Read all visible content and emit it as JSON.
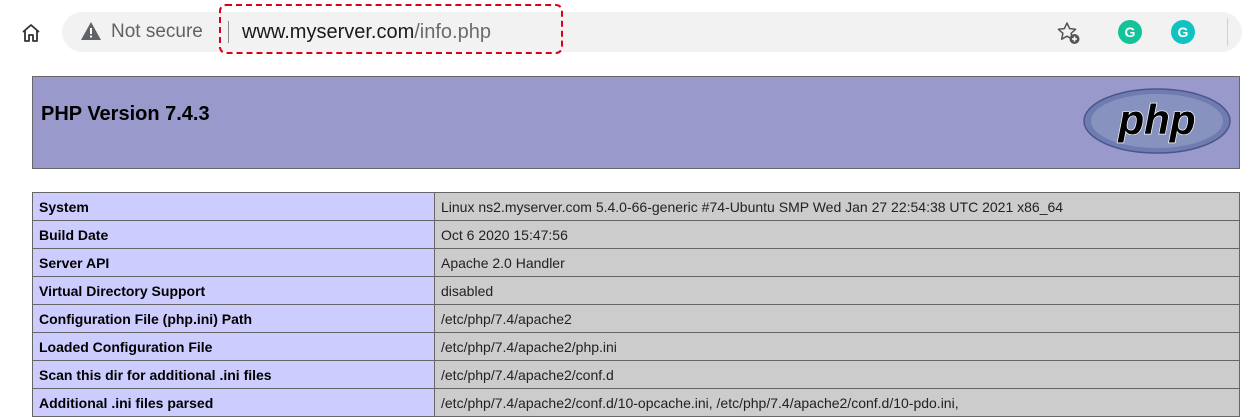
{
  "browser": {
    "security_label": "Not secure",
    "url_host": "www.myserver.com",
    "url_path": "/info.php",
    "extension_1": "G",
    "extension_2": "G"
  },
  "phpinfo": {
    "title": "PHP Version 7.4.3",
    "logo_text": "php",
    "rows": [
      {
        "key": "System",
        "value": "Linux ns2.myserver.com 5.4.0-66-generic #74-Ubuntu SMP Wed Jan 27 22:54:38 UTC 2021 x86_64"
      },
      {
        "key": "Build Date",
        "value": "Oct 6 2020 15:47:56"
      },
      {
        "key": "Server API",
        "value": "Apache 2.0 Handler"
      },
      {
        "key": "Virtual Directory Support",
        "value": "disabled"
      },
      {
        "key": "Configuration File (php.ini) Path",
        "value": "/etc/php/7.4/apache2"
      },
      {
        "key": "Loaded Configuration File",
        "value": "/etc/php/7.4/apache2/php.ini"
      },
      {
        "key": "Scan this dir for additional .ini files",
        "value": "/etc/php/7.4/apache2/conf.d"
      },
      {
        "key": "Additional .ini files parsed",
        "value": "/etc/php/7.4/apache2/conf.d/10-opcache.ini, /etc/php/7.4/apache2/conf.d/10-pdo.ini,"
      }
    ]
  },
  "colors": {
    "header_bg": "#9999cc",
    "key_bg": "#ccccff",
    "value_bg": "#cccccc",
    "highlight_border": "#d9001b"
  },
  "icons": [
    "home-icon",
    "warning-icon",
    "add-favorite-icon",
    "grammarly-icon"
  ]
}
